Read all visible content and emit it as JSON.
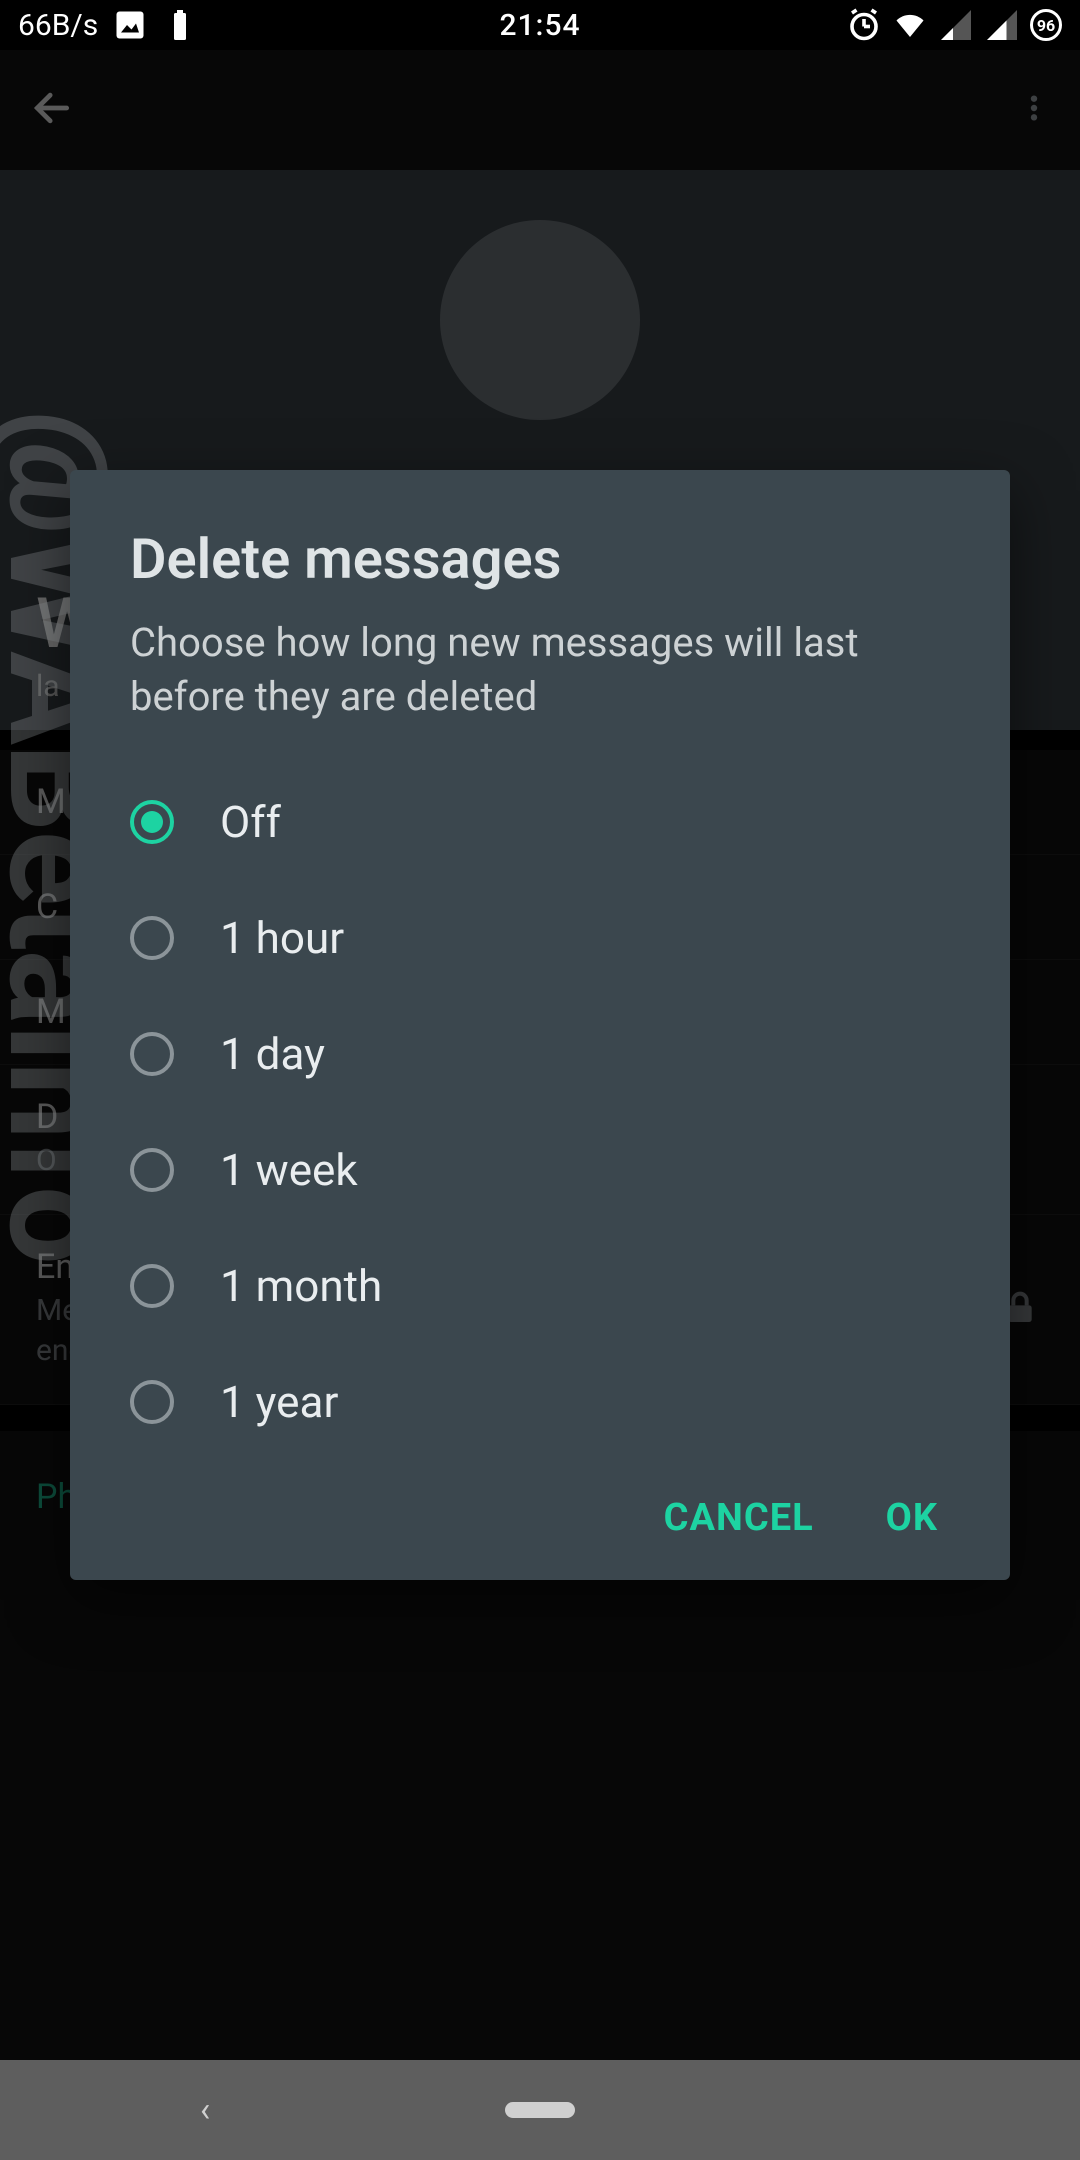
{
  "status": {
    "net_speed": "66B/s",
    "time": "21:54",
    "speed_badge": "96"
  },
  "background": {
    "contact_name_fragment": "W",
    "contact_sub_fragment": "la",
    "rows": {
      "0": "M",
      "1": "C",
      "2": "M",
      "3_title": "D",
      "3_sub": "O"
    },
    "encryption": {
      "title": "Encryption",
      "sub": "Messages to this chat and calls are secured with end-to-end encryption. Tap to verify."
    },
    "phone_section_title": "Phone number"
  },
  "dialog": {
    "title": "Delete messages",
    "description": "Choose how long new messages will last before they are deleted",
    "options": [
      {
        "label": "Off",
        "selected": true
      },
      {
        "label": "1 hour",
        "selected": false
      },
      {
        "label": "1 day",
        "selected": false
      },
      {
        "label": "1 week",
        "selected": false
      },
      {
        "label": "1 month",
        "selected": false
      },
      {
        "label": "1 year",
        "selected": false
      }
    ],
    "cancel_label": "CANCEL",
    "ok_label": "OK"
  },
  "watermark": "@WABetaInfo"
}
